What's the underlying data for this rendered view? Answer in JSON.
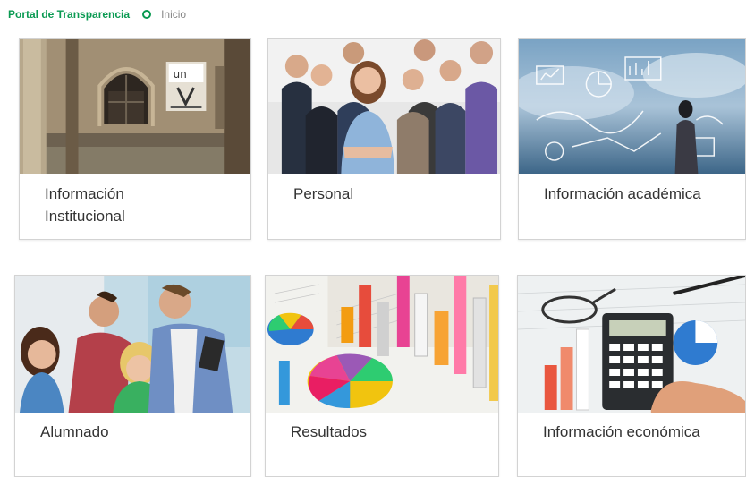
{
  "breadcrumb": {
    "root": "Portal de Transparencia",
    "current": "Inicio"
  },
  "accent_color": "#0a9a52",
  "cards": [
    {
      "label_line1": "Información",
      "label_line2": "Institucional",
      "image": "historic-courtyard-building"
    },
    {
      "label": "Personal",
      "image": "group-of-people"
    },
    {
      "label": "Información académica",
      "image": "sky-sketch-person"
    },
    {
      "label": "Alumnado",
      "image": "students-group"
    },
    {
      "label": "Resultados",
      "image": "bar-pie-charts"
    },
    {
      "label": "Información económica",
      "image": "calculator-finance"
    }
  ],
  "photo_text": {
    "sign_logo": "un"
  }
}
